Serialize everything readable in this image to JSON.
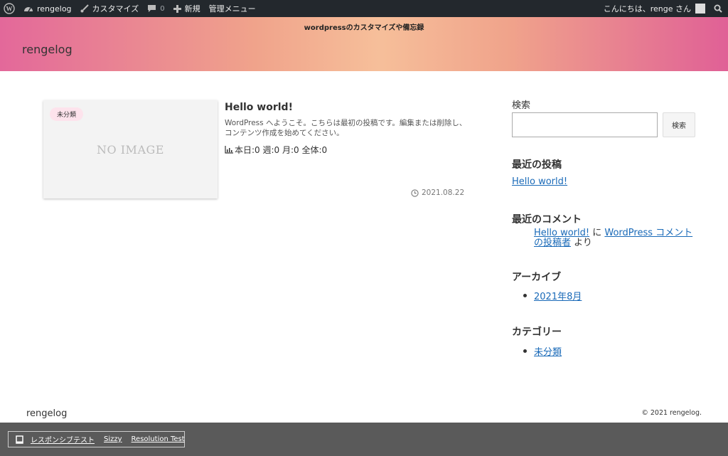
{
  "adminbar": {
    "site_name": "rengelog",
    "customize": "カスタマイズ",
    "comments_count": "0",
    "new_label": "新規",
    "admin_menu": "管理メニュー",
    "greeting": "こんにちは、renge さん"
  },
  "header": {
    "tagline": "wordpressのカスタマイズや備忘録",
    "site_title": "rengelog"
  },
  "post": {
    "category_badge": "未分類",
    "no_image": "NO IMAGE",
    "title": "Hello world!",
    "excerpt": "WordPress へようこそ。こちらは最初の投稿です。編集または削除し、コンテンツ作成を始めてください。",
    "views": "本日:0 週:0 月:0 全体:0",
    "date": "2021.08.22"
  },
  "sidebar": {
    "search_label": "検索",
    "search_placeholder": "",
    "search_button": "検索",
    "recent_posts_title": "最近の投稿",
    "recent_posts": [
      "Hello world!"
    ],
    "recent_comments_title": "最近のコメント",
    "comment": {
      "post_link": "Hello world!",
      "ni": "に",
      "author_link": "WordPress コメントの投稿者",
      "yori": "より"
    },
    "archives_title": "アーカイブ",
    "archives": [
      "2021年8月"
    ],
    "categories_title": "カテゴリー",
    "categories": [
      "未分類"
    ]
  },
  "footer": {
    "site_title": "rengelog",
    "copyright": "© 2021 rengelog."
  },
  "bottombar": {
    "responsive_test": "レスポンシブテスト",
    "sizzy": "Sizzy",
    "resolution_test": "Resolution Test"
  },
  "colors": {
    "adminbar_bg": "#23282d",
    "link": "#1a6ab8",
    "header_gradient_left": "#e3689a",
    "header_gradient_center": "#f6bf9a",
    "bottombar_bg": "#5a5a5a"
  }
}
